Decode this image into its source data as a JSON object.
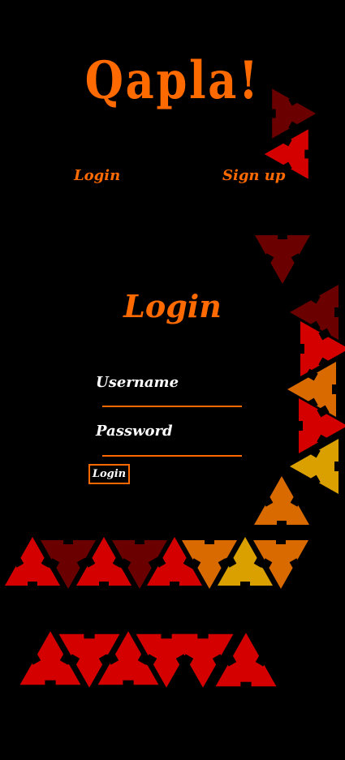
{
  "app": {
    "logo_text": "Qapla!"
  },
  "nav": {
    "login_label": "Login",
    "signup_label": "Sign up"
  },
  "form": {
    "title": "Login",
    "username_label": "Username",
    "username_value": "",
    "password_label": "Password",
    "password_value": "",
    "submit_label": "Login"
  },
  "colors": {
    "accent": "#ff6a00",
    "background": "#000000",
    "text": "#ffffff",
    "tile_red": "#d40000",
    "tile_dark_red": "#6b0000",
    "tile_orange": "#d96a00",
    "tile_gold": "#d9a000"
  }
}
